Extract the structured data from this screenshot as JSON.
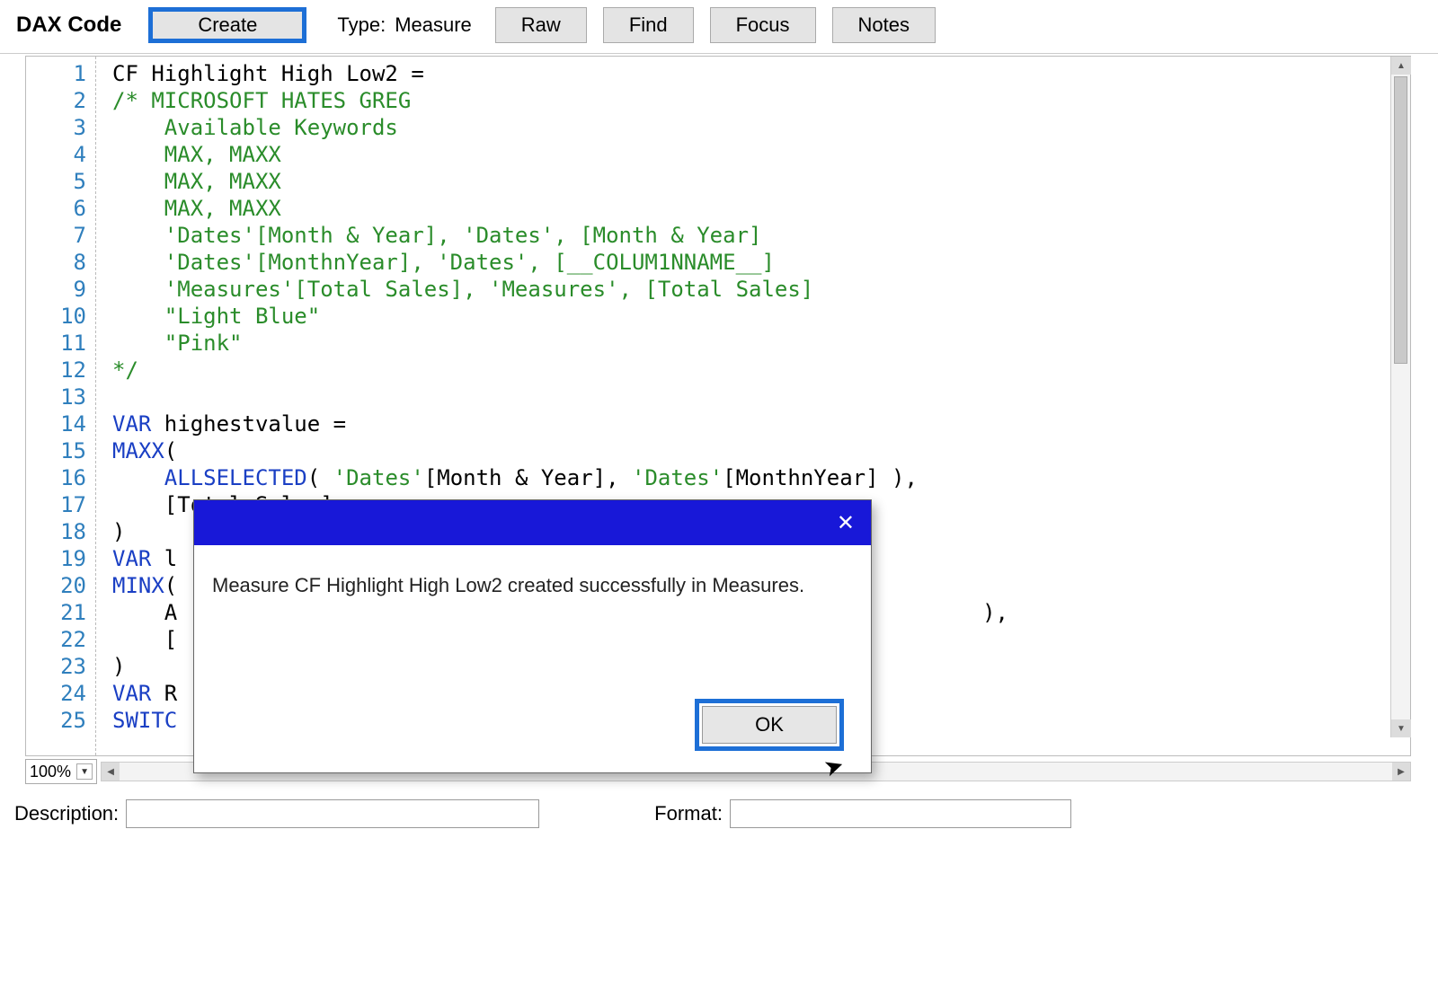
{
  "toolbar": {
    "title": "DAX Code",
    "create_label": "Create",
    "type_label": "Type:",
    "type_value": "Measure",
    "raw_label": "Raw",
    "find_label": "Find",
    "focus_label": "Focus",
    "notes_label": "Notes"
  },
  "code_lines": [
    [
      [
        "black",
        "CF Highlight High Low2 ="
      ]
    ],
    [
      [
        "comment",
        "/* MICROSOFT HATES GREG"
      ]
    ],
    [
      [
        "comment",
        "    Available Keywords"
      ]
    ],
    [
      [
        "comment",
        "    MAX, MAXX"
      ]
    ],
    [
      [
        "comment",
        "    MAX, MAXX"
      ]
    ],
    [
      [
        "comment",
        "    MAX, MAXX"
      ]
    ],
    [
      [
        "comment",
        "    'Dates'[Month & Year], 'Dates', [Month & Year]"
      ]
    ],
    [
      [
        "comment",
        "    'Dates'[MonthnYear], 'Dates', [__COLUM1NNAME__]"
      ]
    ],
    [
      [
        "comment",
        "    'Measures'[Total Sales], 'Measures', [Total Sales]"
      ]
    ],
    [
      [
        "comment",
        "    \"Light Blue\""
      ]
    ],
    [
      [
        "comment",
        "    \"Pink\""
      ]
    ],
    [
      [
        "comment",
        "*/"
      ]
    ],
    [
      [
        "black",
        ""
      ]
    ],
    [
      [
        "kw",
        "VAR "
      ],
      [
        "black",
        "highestvalue ="
      ]
    ],
    [
      [
        "kw",
        "MAXX"
      ],
      [
        "black",
        "("
      ]
    ],
    [
      [
        "black",
        "    "
      ],
      [
        "kw",
        "ALLSELECTED"
      ],
      [
        "black",
        "( "
      ],
      [
        "comment",
        "'Dates'"
      ],
      [
        "black",
        "[Month & Year], "
      ],
      [
        "comment",
        "'Dates'"
      ],
      [
        "black",
        "[MonthnYear] ),"
      ]
    ],
    [
      [
        "black",
        "    [Total Sales]"
      ]
    ],
    [
      [
        "black",
        ")"
      ]
    ],
    [
      [
        "kw",
        "VAR "
      ],
      [
        "black",
        "l"
      ]
    ],
    [
      [
        "kw",
        "MINX"
      ],
      [
        "black",
        "("
      ]
    ],
    [
      [
        "black",
        "    A                                                              ),"
      ]
    ],
    [
      [
        "black",
        "    ["
      ]
    ],
    [
      [
        "black",
        ")"
      ]
    ],
    [
      [
        "kw",
        "VAR "
      ],
      [
        "black",
        "R"
      ]
    ],
    [
      [
        "kw",
        "SWITC"
      ]
    ]
  ],
  "zoom": {
    "value": "100%"
  },
  "footer": {
    "description_label": "Description:",
    "description_value": "",
    "format_label": "Format:",
    "format_value": ""
  },
  "dialog": {
    "message": "Measure CF Highlight High Low2 created successfully in Measures.",
    "ok_label": "OK"
  }
}
